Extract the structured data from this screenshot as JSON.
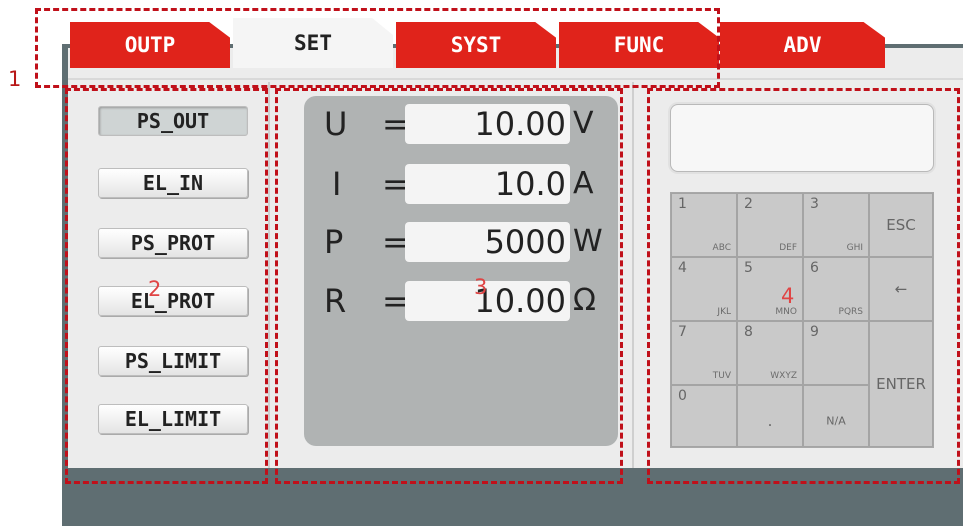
{
  "tabs": [
    {
      "label": "OUTP",
      "active": false
    },
    {
      "label": "SET",
      "active": true
    },
    {
      "label": "SYST",
      "active": false
    },
    {
      "label": "FUNC",
      "active": false
    },
    {
      "label": "ADV",
      "active": false
    }
  ],
  "nav": [
    {
      "label": "PS_OUT",
      "active": true
    },
    {
      "label": "EL_IN",
      "active": false
    },
    {
      "label": "PS_PROT",
      "active": false
    },
    {
      "label": "EL_PROT",
      "active": false
    },
    {
      "label": "PS_LIMIT",
      "active": false
    },
    {
      "label": "EL_LIMIT",
      "active": false
    }
  ],
  "values": [
    {
      "symbol": "U",
      "eq": "=",
      "value": "10.00",
      "unit": "V"
    },
    {
      "symbol": "I",
      "eq": "=",
      "value": "10.0",
      "unit": "A"
    },
    {
      "symbol": "P",
      "eq": "=",
      "value": "5000",
      "unit": "W"
    },
    {
      "symbol": "R",
      "eq": "=",
      "value": "10.00",
      "unit": "Ω"
    }
  ],
  "keypad": {
    "display": "",
    "keys": {
      "k1": {
        "num": "1",
        "sub": "ABC"
      },
      "k2": {
        "num": "2",
        "sub": "DEF"
      },
      "k3": {
        "num": "3",
        "sub": "GHI"
      },
      "k4": {
        "num": "4",
        "sub": "JKL"
      },
      "k5": {
        "num": "5",
        "sub": "MNO"
      },
      "k6": {
        "num": "6",
        "sub": "PQRS"
      },
      "k7": {
        "num": "7",
        "sub": "TUV"
      },
      "k8": {
        "num": "8",
        "sub": "WXYZ"
      },
      "k9": {
        "num": "9",
        "sub": ""
      },
      "k0": {
        "num": "0",
        "sub": ""
      },
      "dot": ".",
      "na": "N/A",
      "esc": "ESC",
      "back": "←",
      "enter": "ENTER"
    }
  },
  "annotations": {
    "a1": "1",
    "a2": "2",
    "a3": "3",
    "a4": "4"
  },
  "colors": {
    "tab_red": "#e0231b",
    "annotation": "#c0101a",
    "frame": "#5f6e72"
  }
}
